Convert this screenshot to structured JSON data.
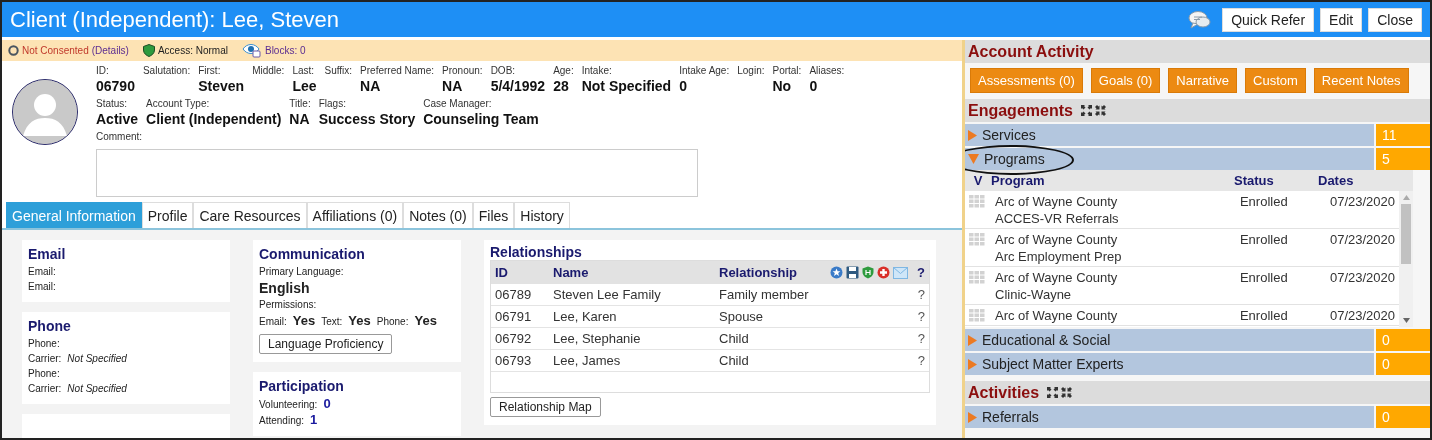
{
  "window": {
    "title": "Client (Independent): Lee, Steven",
    "buttons": [
      "Quick Refer",
      "Edit",
      "Close"
    ]
  },
  "consent_bar": {
    "consent": "Not Consented",
    "details": "(Details)",
    "access": "Access: Normal",
    "blocks": "Blocks: 0"
  },
  "profile": {
    "identity_fields": [
      {
        "label": "ID:",
        "value": "06790"
      },
      {
        "label": "Salutation:"
      },
      {
        "label": "First:",
        "value": "Steven"
      },
      {
        "label": "Middle:"
      },
      {
        "label": "Last:",
        "value": "Lee"
      },
      {
        "label": "Suffix:"
      },
      {
        "label": "Preferred Name:",
        "value": "NA"
      },
      {
        "label": "Pronoun:",
        "value": "NA"
      },
      {
        "label": "DOB:",
        "value": "5/4/1992"
      },
      {
        "label": "Age:",
        "value": "28"
      },
      {
        "label": "Intake:",
        "value": "Not Specified"
      },
      {
        "label": "Intake Age:",
        "value": "0"
      },
      {
        "label": "Login:"
      },
      {
        "label": "Portal:",
        "value": "No"
      },
      {
        "label": "Aliases:",
        "value": "0"
      }
    ],
    "account_fields": [
      {
        "label": "Status:",
        "value": "Active"
      },
      {
        "label": "Account Type:",
        "value": "Client (Independent)"
      },
      {
        "label": "Title:",
        "value": "NA"
      },
      {
        "label": "Flags:",
        "value": "Success Story"
      },
      {
        "label": "Case Manager:",
        "value": "Counseling Team"
      }
    ],
    "comment_label": "Comment:"
  },
  "tabs": [
    {
      "label": "General Information",
      "selected": true
    },
    {
      "label": "Profile",
      "selected": false
    },
    {
      "label": "Care Resources",
      "selected": false
    },
    {
      "label": "Affiliations (0)",
      "selected": false
    },
    {
      "label": "Notes (0)",
      "selected": false
    },
    {
      "label": "Files",
      "selected": false
    },
    {
      "label": "History",
      "selected": false
    }
  ],
  "email_card": {
    "title": "Email",
    "lines": [
      "Email:",
      "Email:"
    ]
  },
  "phone_card": {
    "title": "Phone",
    "lines": [
      {
        "label": "Phone:"
      },
      {
        "label": "Carrier:",
        "value": "Not Specified"
      },
      {
        "label": "Phone:"
      },
      {
        "label": "Carrier:",
        "value": "Not Specified"
      }
    ]
  },
  "communication": {
    "title": "Communication",
    "language_label": "Primary Language:",
    "language": "English",
    "permissions_label": "Permissions:",
    "permissions": [
      {
        "label": "Email:",
        "value": "Yes"
      },
      {
        "label": "Text:",
        "value": "Yes"
      },
      {
        "label": "Phone:",
        "value": "Yes"
      }
    ],
    "button": "Language Proficiency"
  },
  "participation": {
    "title": "Participation",
    "items": [
      {
        "label": "Volunteering:",
        "value": "0"
      },
      {
        "label": "Attending:",
        "value": "1"
      }
    ]
  },
  "relationships": {
    "title": "Relationships",
    "columns": [
      "ID",
      "Name",
      "Relationship",
      "?"
    ],
    "rows": [
      {
        "id": "06789",
        "name": "Steven Lee Family",
        "relationship": "Family member",
        "info": "?"
      },
      {
        "id": "06791",
        "name": "Lee, Karen",
        "relationship": "Spouse",
        "info": "?"
      },
      {
        "id": "06792",
        "name": "Lee, Stephanie",
        "relationship": "Child",
        "info": "?"
      },
      {
        "id": "06793",
        "name": "Lee, James",
        "relationship": "Child",
        "info": "?"
      }
    ],
    "button": "Relationship Map"
  },
  "account_activity": {
    "title": "Account Activity",
    "buttons": [
      "Assessments (0)",
      "Goals (0)",
      "Narrative",
      "Custom",
      "Recent Notes"
    ]
  },
  "engagements": {
    "title": "Engagements",
    "groups": [
      {
        "label": "Services",
        "count": "11",
        "expanded": false
      },
      {
        "label": "Programs",
        "count": "5",
        "expanded": true,
        "highlighted": true,
        "columns": [
          "V",
          "Program",
          "Status",
          "Dates"
        ],
        "rows": [
          {
            "organization": "Arc of Wayne County",
            "program": "ACCES-VR Referrals",
            "status": "Enrolled",
            "date": "07/23/2020"
          },
          {
            "organization": "Arc of Wayne County",
            "program": "Arc Employment Prep",
            "status": "Enrolled",
            "date": "07/23/2020"
          },
          {
            "organization": "Arc of Wayne County",
            "program": "Clinic-Wayne",
            "status": "Enrolled",
            "date": "07/23/2020"
          },
          {
            "organization": "Arc of Wayne County",
            "status": "Enrolled",
            "date": "07/23/2020"
          }
        ]
      },
      {
        "label": "Educational & Social",
        "count": "0",
        "expanded": false
      },
      {
        "label": "Subject Matter Experts",
        "count": "0",
        "expanded": false
      }
    ]
  },
  "activities": {
    "title": "Activities",
    "groups": [
      {
        "label": "Referrals",
        "count": "0",
        "expanded": false
      }
    ]
  }
}
